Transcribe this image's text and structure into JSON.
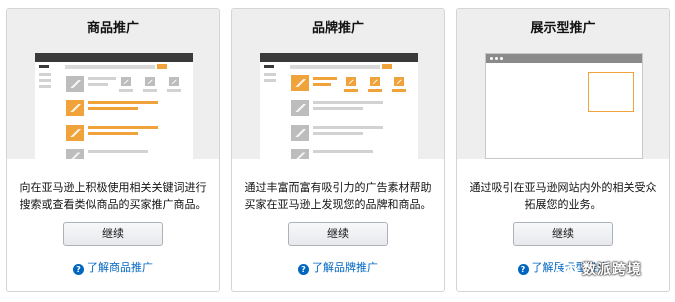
{
  "cards": [
    {
      "title": "商品推广",
      "desc_line1": "向在亚马逊上积极使用相关关键词进行",
      "desc_line2": "搜索或查看类似商品的买家推广商品。",
      "button_label": "继续",
      "learn_more": "了解商品推广"
    },
    {
      "title": "品牌推广",
      "desc_line1": "通过丰富而富有吸引力的广告素材帮助",
      "desc_line2": "买家在亚马逊上发现您的品牌和商品。",
      "button_label": "继续",
      "learn_more": "了解品牌推广"
    },
    {
      "title": "展示型推广",
      "desc_line1": "通过吸引在亚马逊网站内外的相关受众",
      "desc_line2": "拓展您的业务。",
      "button_label": "继续",
      "learn_more": "了解展示型推广"
    }
  ],
  "watermark": {
    "text": "数派跨境"
  },
  "colors": {
    "accent_orange": "#f0a33a",
    "link_blue": "#0066c0",
    "header_gray": "#eeeeee"
  }
}
